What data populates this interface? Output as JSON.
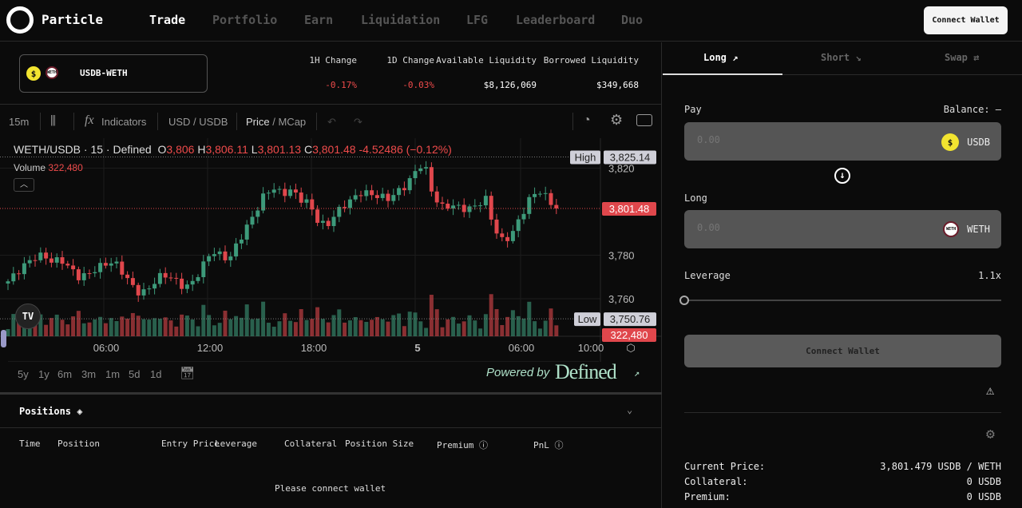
{
  "nav": {
    "brand": "Particle",
    "links": [
      "Trade",
      "Portfolio",
      "Earn",
      "Liquidation",
      "LFG",
      "Leaderboard",
      "Duo"
    ],
    "active": "Trade",
    "connect": "Connect Wallet"
  },
  "pair": {
    "name": "USDB-WETH"
  },
  "stats": [
    {
      "label": "1H Change",
      "value": "-0.17%"
    },
    {
      "label": "1D Change",
      "value": "-0.03%"
    },
    {
      "label": "Available Liquidity",
      "value": "$8,126,069"
    },
    {
      "label": "Borrowed Liquidity",
      "value": "$349,668"
    }
  ],
  "toolbar": {
    "interval": "15m",
    "indicators": "Indicators",
    "currency": "USD / USDB",
    "price": "Price",
    "mcap": "/ MCap"
  },
  "legend": {
    "symbol": "WETH/USDB · 15 · Defined",
    "o": "3,806",
    "h": "3,806.11",
    "l": "3,801.13",
    "c": "3,801.48",
    "chg": "-4.52486 (−0.12%)",
    "volume_label": "Volume",
    "volume": "322,480"
  },
  "chart_data": {
    "type": "candlestick",
    "price_ticks": [
      3820,
      3780,
      3760
    ],
    "price_tick_labels": [
      "3,820",
      "3,780",
      "3,760"
    ],
    "time_ticks": [
      "06:00",
      "12:00",
      "18:00",
      "5",
      "06:00",
      "10:00"
    ],
    "high_label": "High",
    "high": "3,825.14",
    "low_label": "Low",
    "low": "3,750.76",
    "last": "3,801.48",
    "last_volume": "322,480",
    "close_path": [
      3768,
      3772,
      3776,
      3779,
      3780,
      3777,
      3778,
      3774,
      3770,
      3771,
      3774,
      3776,
      3777,
      3772,
      3766,
      3762,
      3765,
      3770,
      3771,
      3768,
      3765,
      3768,
      3775,
      3782,
      3780,
      3778,
      3786,
      3793,
      3800,
      3808,
      3811,
      3808,
      3810,
      3806,
      3804,
      3796,
      3793,
      3799,
      3803,
      3806,
      3809,
      3808,
      3807,
      3806,
      3809,
      3812,
      3818,
      3823,
      3808,
      3802,
      3803,
      3802,
      3801,
      3803,
      3806,
      3792,
      3786,
      3790,
      3798,
      3806,
      3810,
      3806,
      3801
    ],
    "colors": {
      "up": "#3d9a7a",
      "down": "#e0474c"
    }
  },
  "ranges": [
    "5y",
    "1y",
    "6m",
    "3m",
    "1m",
    "5d",
    "1d"
  ],
  "powered": {
    "prefix": "Powered by",
    "brand": "Defined"
  },
  "positions": {
    "title": "Positions",
    "columns": [
      "Time",
      "Position",
      "Entry Price",
      "Leverage",
      "Collateral",
      "Position Size",
      "Premium",
      "PnL"
    ],
    "empty": "Please connect wallet"
  },
  "trade": {
    "tabs": [
      "Long",
      "Short",
      "Swap"
    ],
    "active": "Long",
    "pay_label": "Pay",
    "balance": "Balance: –",
    "pay_placeholder": "0.00",
    "pay_token": "USDB",
    "long_label": "Long",
    "long_placeholder": "0.00",
    "long_token": "WETH",
    "leverage_label": "Leverage",
    "leverage": "1.1x",
    "leverage_fraction": 0,
    "connect": "Connect Wallet",
    "info": [
      {
        "label": "Current Price:",
        "value": "3,801.479 USDB / WETH"
      },
      {
        "label": "Collateral:",
        "value": "0 USDB"
      },
      {
        "label": "Premium:",
        "value": "0 USDB"
      }
    ]
  }
}
